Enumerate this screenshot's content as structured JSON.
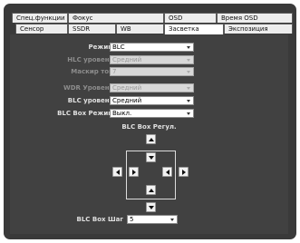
{
  "tabs_row1": [
    {
      "label": "Спец.функции"
    },
    {
      "label": "Фокус"
    },
    {
      "label": "OSD"
    },
    {
      "label": "Время OSD"
    }
  ],
  "tabs_row2": [
    {
      "label": "Сенсор"
    },
    {
      "label": "SSDR"
    },
    {
      "label": "WB"
    },
    {
      "label": "Засветка",
      "active": true
    },
    {
      "label": "Экспозиция"
    }
  ],
  "settings": [
    {
      "label": "Режим",
      "value": "BLC",
      "enabled": true
    },
    {
      "label": "HLC уровень",
      "value": "Средний",
      "enabled": false
    },
    {
      "label": "Маскир той",
      "value": "7",
      "enabled": false
    },
    {
      "label": "WDR Уровень",
      "value": "Средний",
      "enabled": false
    },
    {
      "label": "BLC уровень",
      "value": "Средний",
      "enabled": true
    },
    {
      "label": "BLC Box Режим",
      "value": "Выкл.",
      "enabled": true
    }
  ],
  "blc_box": {
    "title": "BLC Box Регул.",
    "step_label": "BLC Box Шаг",
    "step_value": "5"
  },
  "colors": {
    "panel_bg": "#414141",
    "frame_bg": "#3a3a3a",
    "label_enabled": "#e0e0e0",
    "label_disabled": "#8c8c8c"
  }
}
